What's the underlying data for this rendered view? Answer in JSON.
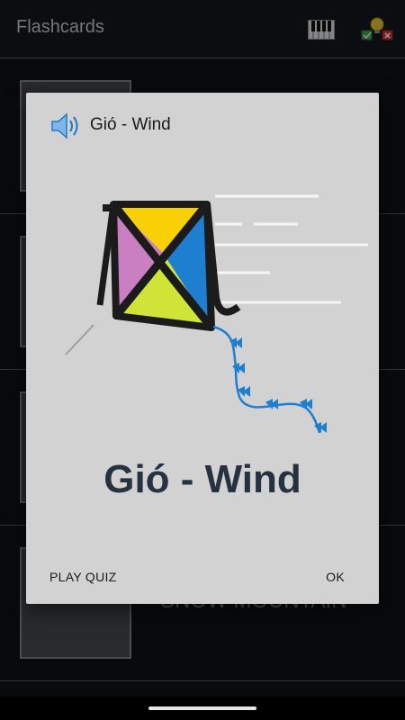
{
  "app": {
    "title": "Flashcards",
    "icons": [
      "piano-icon",
      "quiz-icon"
    ]
  },
  "list": {
    "items": [
      {
        "label": ""
      },
      {
        "label": ""
      },
      {
        "label": ""
      },
      {
        "label": "SNOW MOUNTAIN"
      }
    ]
  },
  "dialog": {
    "title": "Gió - Wind",
    "word": "Gió - Wind",
    "play_quiz_label": "PLAY QUIZ",
    "ok_label": "OK",
    "icons": [
      "speaker-icon",
      "kite-wind-illustration"
    ]
  }
}
